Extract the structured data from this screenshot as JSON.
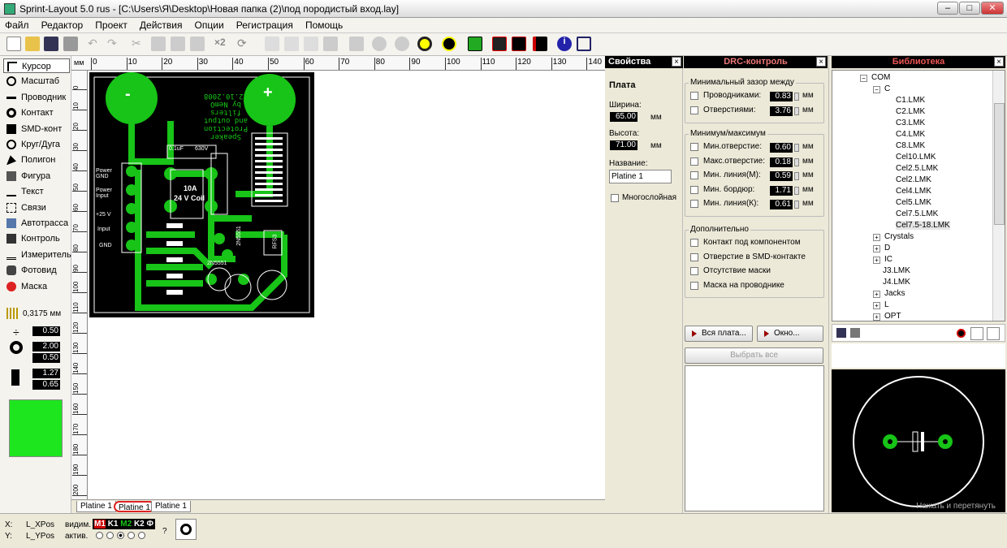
{
  "window": {
    "title": "Sprint-Layout 5.0 rus  -  [C:\\Users\\Я\\Desktop\\Новая папка (2)\\под породистый вход.lay]",
    "min": "–",
    "max": "□",
    "close": "✕"
  },
  "menu": [
    "Файл",
    "Редактор",
    "Проект",
    "Действия",
    "Опции",
    "Регистрация",
    "Помощь"
  ],
  "toolbar": {
    "icons": [
      "new-icon",
      "open-icon",
      "save-icon",
      "print-icon",
      "undo-icon",
      "redo-icon",
      "cut-icon",
      "copy-icon",
      "paste-icon",
      "delete-icon",
      "duplicate-icon",
      "rotate-icon",
      "mirror-icon",
      "align-icon",
      "group-icon",
      "ungroup-icon",
      "lock-icon",
      "zoom-icon",
      "view-icon",
      "drc-icon",
      "photo-icon",
      "info-icon",
      "crop-icon"
    ],
    "x2": "×2"
  },
  "tools": [
    {
      "label": "Курсор",
      "icon": "cursor-icon",
      "selected": true
    },
    {
      "label": "Масштаб",
      "icon": "zoom-icon"
    },
    {
      "label": "Проводник",
      "icon": "track-icon"
    },
    {
      "label": "Контакт",
      "icon": "pad-icon"
    },
    {
      "label": "SMD-конт",
      "icon": "smd-pad-icon"
    },
    {
      "label": "Круг/Дуга",
      "icon": "circle-icon"
    },
    {
      "label": "Полигон",
      "icon": "polygon-icon"
    },
    {
      "label": "Фигура",
      "icon": "shape-icon"
    },
    {
      "label": "Текст",
      "icon": "text-icon"
    },
    {
      "label": "Связи",
      "icon": "connections-icon"
    },
    {
      "label": "Автотрасса",
      "icon": "autoroute-icon"
    },
    {
      "label": "Контроль",
      "icon": "test-icon"
    },
    {
      "label": "Измеритель",
      "icon": "measure-icon"
    },
    {
      "label": "Фотовид",
      "icon": "photoview-icon"
    },
    {
      "label": "Маска",
      "icon": "mask-icon"
    }
  ],
  "grid": {
    "value": "0,3175 мм"
  },
  "params": {
    "track_width": "0.50",
    "pad_outer": "2.00",
    "pad_inner": "0.50",
    "smd_w": "1.27",
    "smd_h": "0.65"
  },
  "colors": {
    "swatch": "#1ee61e",
    "board": "#000000",
    "copper": "#17c417"
  },
  "ruler": {
    "unit": "мм",
    "h_ticks": [
      "0",
      "10",
      "20",
      "30",
      "40",
      "50",
      "60",
      "70",
      "80",
      "90",
      "100",
      "110",
      "120",
      "130",
      "140"
    ],
    "v_ticks": [
      "0",
      "10",
      "20",
      "30",
      "40",
      "50",
      "60",
      "70",
      "80",
      "90",
      "100",
      "110",
      "120",
      "130",
      "140",
      "150",
      "160",
      "170",
      "180",
      "190",
      "200",
      "210"
    ]
  },
  "board": {
    "text_lines": [
      "Speaker Protection",
      "and output filters",
      "by NemO",
      "12.10.2008"
    ],
    "labels": [
      "Power GND",
      "Power Input",
      "+25 V",
      "Input",
      "GND",
      "0.1uF",
      "630V",
      "10A",
      "24 V Coil",
      "2N5551",
      "2N5551",
      "RFS3"
    ],
    "minus": "-",
    "plus": "+"
  },
  "tabs": [
    "Platine 1",
    "Platine 1",
    "Platine 1"
  ],
  "status": {
    "x_label": "X:",
    "y_label": "Y:",
    "x_val": "L_XPos",
    "y_val": "L_YPos",
    "visible": "видим.",
    "active": "актив.",
    "layers": [
      "M1",
      "K1",
      "M2",
      "K2",
      "Ф"
    ],
    "help": "?"
  },
  "props": {
    "title": "Свойства",
    "section": "Плата",
    "width_label": "Ширина:",
    "width": "65.00",
    "height_label": "Высота:",
    "height": "71.00",
    "unit": "мм",
    "name_label": "Название:",
    "name": "Platine 1",
    "multilayer": "Многослойная"
  },
  "drc": {
    "title": "DRC-контроль",
    "g1": "Минимальный зазор между",
    "g1_items": [
      {
        "label": "Проводниками:",
        "value": "0.83"
      },
      {
        "label": "Отверстиями:",
        "value": "3.76"
      }
    ],
    "g2": "Минимум/максимум",
    "g2_items": [
      {
        "label": "Мин.отверстие:",
        "value": "0.60"
      },
      {
        "label": "Макс.отверстие:",
        "value": "0.18"
      },
      {
        "label": "Мин. линия(М):",
        "value": "0.59"
      },
      {
        "label": "Мин. бордюр:",
        "value": "1.71"
      },
      {
        "label": "Мин. линия(К):",
        "value": "0.61"
      }
    ],
    "g3": "Дополнительно",
    "g3_items": [
      "Контакт под компонентом",
      "Отверстие в SMD-контакте",
      "Отсутствие маски",
      "Маска на проводнике"
    ],
    "btn_all": "Вся плата...",
    "btn_window": "Окно...",
    "btn_select": "Выбрать все",
    "unit": "мм"
  },
  "library": {
    "title": "Библиотека",
    "root": "COM",
    "folder_c": "C",
    "c_items": [
      "C1.LMK",
      "C2.LMK",
      "C3.LMK",
      "C4.LMK",
      "C8.LMK",
      "Cel10.LMK",
      "Cel2.5.LMK",
      "Cel2.LMK",
      "Cel4.LMK",
      "Cel5.LMK",
      "Cel7.5.LMK",
      "Cel7.5-18.LMK"
    ],
    "other": [
      "Crystals",
      "D",
      "IC",
      "J3.LMK",
      "J4.LMK",
      "Jacks",
      "L",
      "OPT"
    ],
    "hint": "Нажать и перетянуть"
  }
}
